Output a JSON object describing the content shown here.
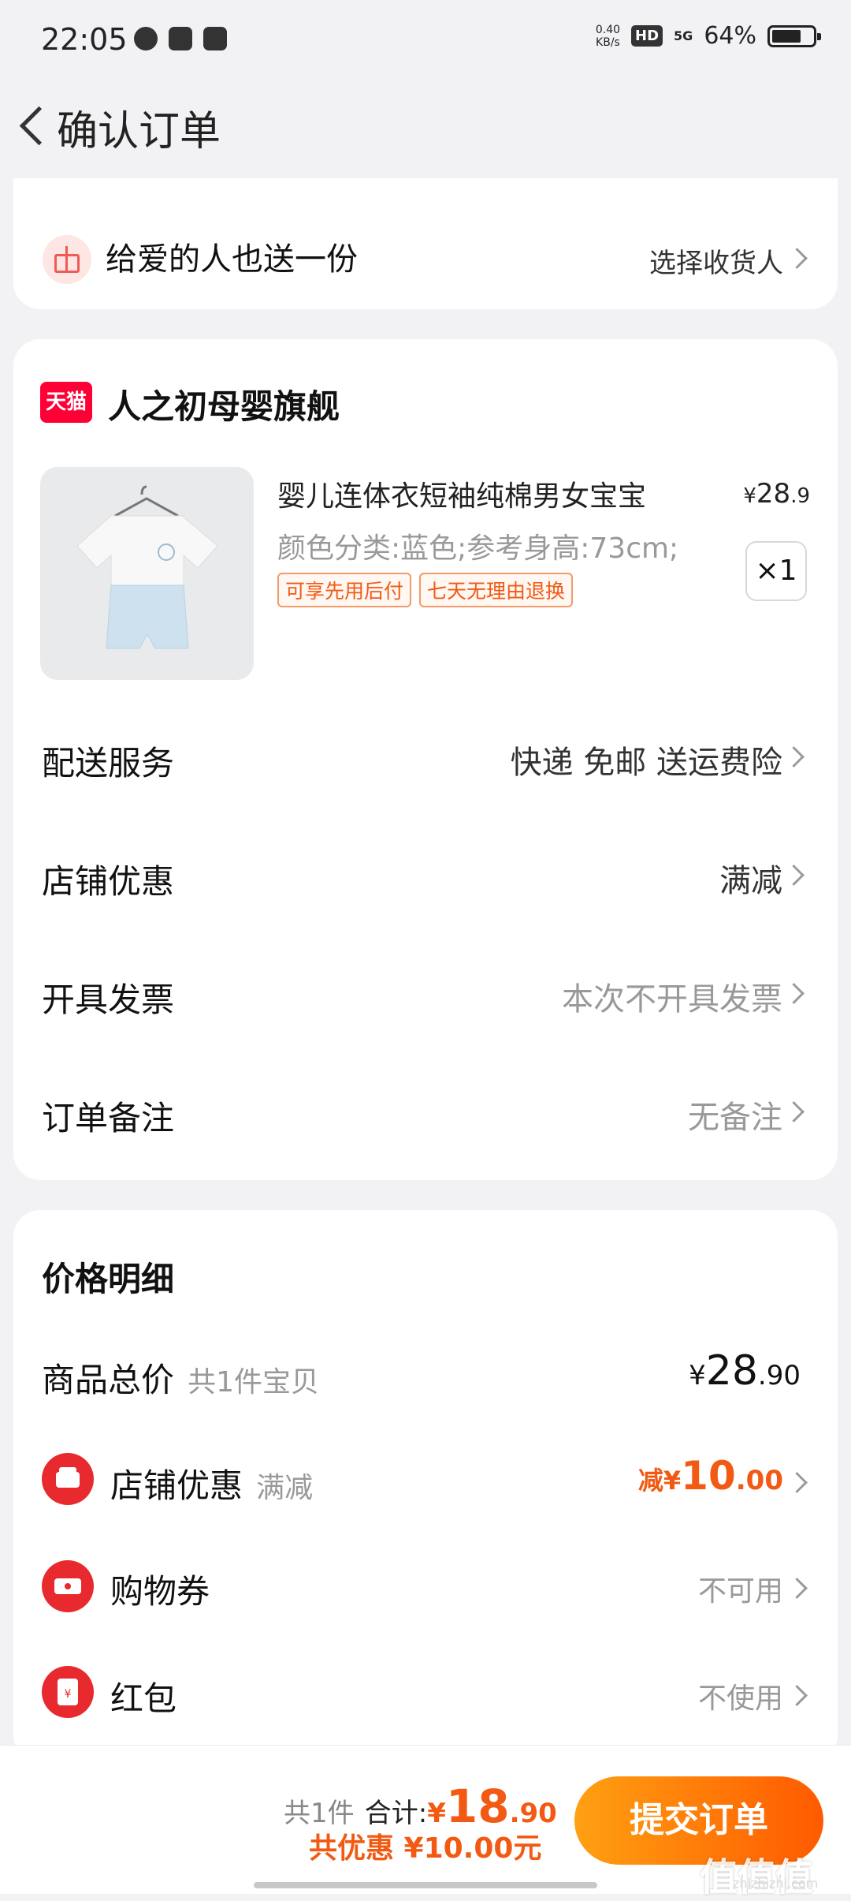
{
  "status_bar": {
    "time": "22:05",
    "net_speed_top": "0.40",
    "net_speed_unit": "KB/s",
    "hd": "HD",
    "signal": "5G",
    "battery": "64%",
    "battery_level": 0.64
  },
  "nav": {
    "title": "确认订单"
  },
  "gift": {
    "label": "给爱的人也送一份",
    "action": "选择收货人"
  },
  "store": {
    "badge": "天猫",
    "name": "人之初母婴旗舰"
  },
  "product": {
    "title": "婴儿连体衣短袖纯棉男女宝宝",
    "price_symbol": "¥",
    "price_int": "28",
    "price_dec": ".9",
    "spec": "颜色分类:蓝色;参考身高:73cm;",
    "tags": [
      "可享先用后付",
      "七天无理由退换"
    ],
    "quantity": "×1"
  },
  "order_rows": [
    {
      "label": "配送服务",
      "value": "快递 免邮 送运费险"
    },
    {
      "label": "店铺优惠",
      "value": "满减"
    },
    {
      "label": "开具发票",
      "value": "本次不开具发票"
    },
    {
      "label": "订单备注",
      "value": "无备注"
    }
  ],
  "price_detail": {
    "title": "价格明细",
    "total_label": "商品总价",
    "total_sub": "共1件宝贝",
    "total_symbol": "¥",
    "total_int": "28",
    "total_dec": ".90",
    "rows": [
      {
        "label": "店铺优惠",
        "sub": "满减",
        "prefix": "减",
        "symbol": "¥",
        "int": "10",
        "dec": ".00"
      },
      {
        "label": "购物券",
        "sub": "",
        "value": "不可用"
      },
      {
        "label": "红包",
        "sub": "",
        "value": "不使用"
      }
    ]
  },
  "footer": {
    "count": "共1件",
    "sum_label": "合计:",
    "sum_symbol": "¥",
    "sum_int": "18",
    "sum_dec": ".90",
    "discount": "共优惠 ¥10.00元",
    "submit": "提交订单"
  },
  "watermark": {
    "text": "值值值",
    "site": "zhizhizhi.com"
  },
  "colors": {
    "accent": "#f25a14",
    "submit_start": "#ffa012",
    "submit_end": "#ff5a00",
    "tmall": "#ff0036"
  }
}
